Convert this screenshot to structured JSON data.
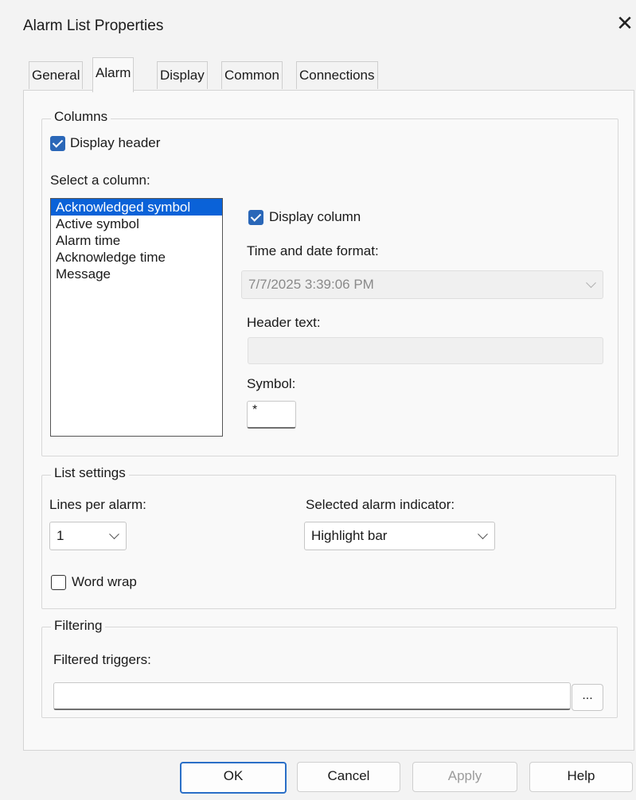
{
  "window": {
    "title": "Alarm List Properties"
  },
  "tabs": [
    {
      "label": "General"
    },
    {
      "label": "Alarm"
    },
    {
      "label": "Display"
    },
    {
      "label": "Common"
    },
    {
      "label": "Connections"
    }
  ],
  "columns_group": {
    "legend": "Columns",
    "display_header_label": "Display header",
    "select_column_label": "Select a column:",
    "column_list": [
      "Acknowledged symbol",
      "Active symbol",
      "Alarm time",
      "Acknowledge time",
      "Message"
    ],
    "selected_column": "Acknowledged symbol",
    "display_column_label": "Display column",
    "time_date_format_label": "Time and date format:",
    "time_date_format_value": "7/7/2025 3:39:06 PM",
    "header_text_label": "Header text:",
    "header_text_value": "",
    "symbol_label": "Symbol:",
    "symbol_value": "*"
  },
  "list_settings": {
    "legend": "List settings",
    "lines_per_alarm_label": "Lines per alarm:",
    "lines_per_alarm_value": "1",
    "selected_indicator_label": "Selected alarm indicator:",
    "selected_indicator_value": "Highlight bar",
    "word_wrap_label": "Word wrap"
  },
  "filtering": {
    "legend": "Filtering",
    "filtered_triggers_label": "Filtered triggers:",
    "filtered_triggers_value": "",
    "browse_label": "..."
  },
  "buttons": {
    "ok": "OK",
    "cancel": "Cancel",
    "apply": "Apply",
    "help": "Help"
  },
  "colors": {
    "accent": "#2a67b8",
    "selection": "#0a62d8"
  }
}
